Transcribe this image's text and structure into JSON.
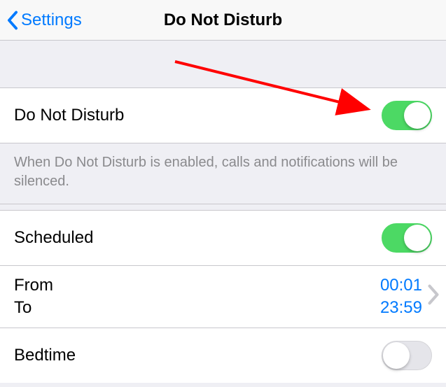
{
  "nav": {
    "back_label": "Settings",
    "title": "Do Not Disturb"
  },
  "dnd": {
    "label": "Do Not Disturb",
    "enabled": true,
    "footer": "When Do Not Disturb is enabled, calls and notifications will be silenced."
  },
  "scheduled": {
    "label": "Scheduled",
    "enabled": true,
    "from_label": "From",
    "to_label": "To",
    "from_time": "00:01",
    "to_time": "23:59"
  },
  "bedtime": {
    "label": "Bedtime",
    "enabled": false
  },
  "colors": {
    "link": "#007aff",
    "switch_on": "#4cd964",
    "annotation": "#ff0000"
  }
}
